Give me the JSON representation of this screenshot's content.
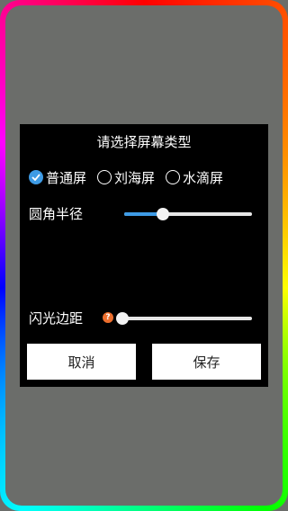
{
  "dialog": {
    "title": "请选择屏幕类型",
    "screen_types": [
      {
        "label": "普通屏",
        "checked": true
      },
      {
        "label": "刘海屏",
        "checked": false
      },
      {
        "label": "水滴屏",
        "checked": false
      }
    ],
    "corner_radius": {
      "label": "圆角半径",
      "value": 0.3
    },
    "flash_margin": {
      "label": "闪光边距",
      "help_glyph": "?",
      "value": 0.0
    },
    "cancel_label": "取消",
    "save_label": "保存"
  },
  "colors": {
    "accent": "#3e9be5",
    "background": "#6b6d6a",
    "dialog": "#000000",
    "help": "#ec6e2d"
  }
}
